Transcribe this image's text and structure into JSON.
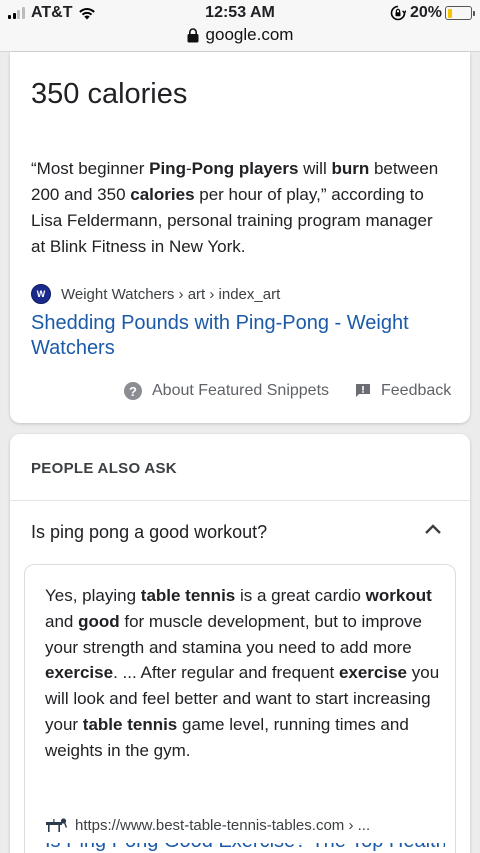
{
  "status_bar": {
    "carrier": "AT&T",
    "time": "12:53 AM",
    "battery_percent": "20%",
    "battery_level": 0.2,
    "signal_bars": 2,
    "icons": [
      "signal-icon",
      "wifi-icon",
      "rotation-lock-icon",
      "battery-icon"
    ]
  },
  "url_bar": {
    "domain": "google.com",
    "icon": "padlock-icon"
  },
  "featured_snippet": {
    "answer": "350 calories",
    "snippet_parts": [
      {
        "t": "“Most beginner ",
        "b": false
      },
      {
        "t": "Ping",
        "b": true
      },
      {
        "t": "-",
        "b": false
      },
      {
        "t": "Pong players",
        "b": true
      },
      {
        "t": " will ",
        "b": false
      },
      {
        "t": "burn",
        "b": true
      },
      {
        "t": " between 200 and 350 ",
        "b": false
      },
      {
        "t": "calories",
        "b": true
      },
      {
        "t": " per hour of play,” according to Lisa Feldermann, personal training program manager at Blink Fitness in New York.",
        "b": false
      }
    ],
    "source_logo_text": "W",
    "source": "Weight Watchers › art › index_art",
    "link_title": "Shedding Pounds with Ping-Pong - Weight Watchers",
    "about_label": "About Featured Snippets",
    "feedback_label": "Feedback"
  },
  "people_also_ask": {
    "heading": "PEOPLE ALSO ASK",
    "question": "Is ping pong a good workout?",
    "answer_parts": [
      {
        "t": "Yes, playing ",
        "b": false
      },
      {
        "t": "table tennis",
        "b": true
      },
      {
        "t": " is a great cardio ",
        "b": false
      },
      {
        "t": "workout",
        "b": true
      },
      {
        "t": " and ",
        "b": false
      },
      {
        "t": "good",
        "b": true
      },
      {
        "t": " for muscle development, but to improve your strength and stamina you need to add more ",
        "b": false
      },
      {
        "t": "exercise",
        "b": true
      },
      {
        "t": ". ... After regular and frequent ",
        "b": false
      },
      {
        "t": "exercise",
        "b": true
      },
      {
        "t": " you will look and feel better and want to start increasing your ",
        "b": false
      },
      {
        "t": "table tennis",
        "b": true
      },
      {
        "t": " game level, running times and weights in the gym.",
        "b": false
      }
    ],
    "source": "https://www.best-table-tennis-tables.com › ...",
    "link_title_partial": "Is Ping Pong Good Exercise? The Top Health"
  },
  "colors": {
    "link": "#1a5aa8",
    "battery_fill": "#f5c400",
    "brand_ww": "#1a2a8c"
  }
}
